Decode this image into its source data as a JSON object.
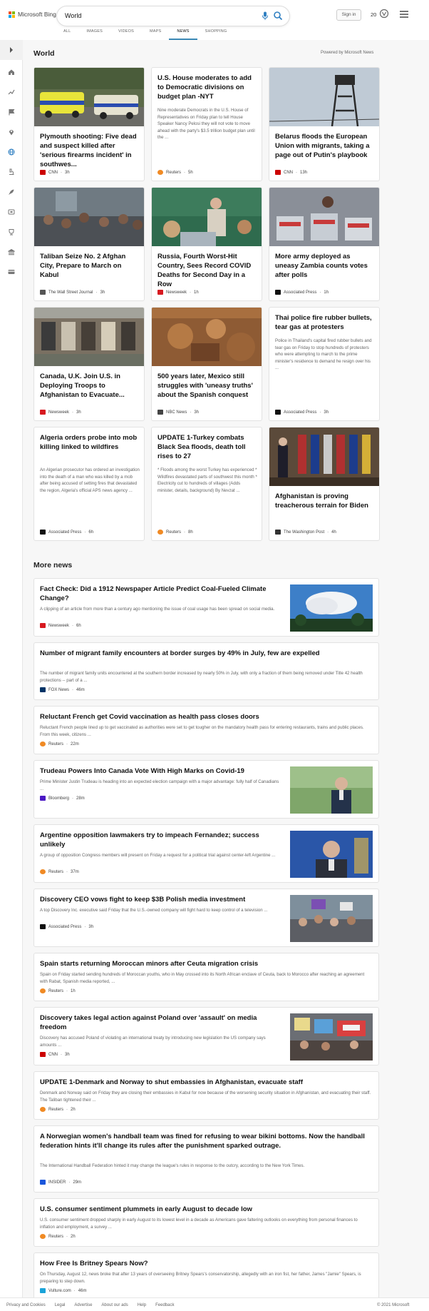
{
  "brand": {
    "name": "Microsoft Bing",
    "colors": [
      "#f25022",
      "#7fba00",
      "#00a4ef",
      "#ffb900"
    ]
  },
  "search": {
    "query": "World"
  },
  "header": {
    "signin_label": "Sign in",
    "rewards_count": "20"
  },
  "tabs": [
    {
      "label": "ALL",
      "active": false
    },
    {
      "label": "IMAGES",
      "active": false
    },
    {
      "label": "VIDEOS",
      "active": false
    },
    {
      "label": "MAPS",
      "active": false
    },
    {
      "label": "NEWS",
      "active": true
    },
    {
      "label": "SHOPPING",
      "active": false
    }
  ],
  "rail": {
    "icons": [
      "chevron-right-icon",
      "home-icon",
      "trending-icon",
      "flag-icon",
      "location-pin-icon",
      "globe-icon",
      "microscope-icon",
      "rocket-icon",
      "entertainment-icon",
      "sports-icon",
      "finance-icon",
      "credit-card-icon"
    ]
  },
  "world": {
    "title": "World",
    "powered_by": "Powered by Microsoft News",
    "cards": [
      {
        "title": "Plymouth shooting: Five dead and suspect killed after 'serious firearms incident' in southwes...",
        "source": "CNN",
        "time": "3h",
        "logo": "#cc0000",
        "image": "police-cars-photo"
      },
      {
        "title": "U.S. House moderates to add to Democratic divisions on budget plan -NYT",
        "snippet": "Nine moderate Democrats in the U.S. House of Representatives on Friday plan to tell House Speaker Nancy Pelosi they will not vote to move ahead with the party's $3.5 trillion budget plan until the ...",
        "source": "Reuters",
        "time": "5h",
        "logo": "#f08a24"
      },
      {
        "title": "Belarus floods the European Union with migrants, taking a page out of Putin's playbook",
        "source": "CNN",
        "time": "13h",
        "logo": "#cc0000",
        "image": "watchtower-photo"
      },
      {
        "title": "Taliban Seize No. 2 Afghan City, Prepare to March on Kabul",
        "source": "The Wall Street Journal",
        "time": "3h",
        "logo": "#555555",
        "image": "crowd-photo"
      },
      {
        "title": "Russia, Fourth Worst-Hit Country, Sees Record COVID Deaths for Second Day in a Row",
        "source": "Newsweek",
        "time": "1h",
        "logo": "#d71920",
        "image": "classroom-photo"
      },
      {
        "title": "More army deployed as uneasy Zambia counts votes after polls",
        "source": "Associated Press",
        "time": "1h",
        "logo": "#111111",
        "image": "ballot-boxes-photo"
      },
      {
        "title": "Canada, U.K. Join U.S. in Deploying Troops to Afghanistan to Evacuate...",
        "source": "Newsweek",
        "time": "3h",
        "logo": "#d71920",
        "image": "mural-wall-photo"
      },
      {
        "title": "500 years later, Mexico still struggles with 'uneasy truths' about the Spanish conquest",
        "source": "NBC News",
        "time": "3h",
        "logo": "#444444",
        "image": "painting-photo"
      },
      {
        "title": "Thai police fire rubber bullets, tear gas at protesters",
        "snippet": "Police in Thailand's capital fired rubber bullets and tear gas on Friday to stop hundreds of protesters who were attempting to march to the prime minister's residence to demand he resign over his ...",
        "source": "Associated Press",
        "time": "3h",
        "logo": "#111111"
      },
      {
        "title": "Algeria orders probe into mob killing linked to wildfires",
        "snippet": "An Algerian prosecutor has ordered an investigation into the death of a man who was killed by a mob after being accused of setting fires that devastated the region, Algeria's official APS news agency ...",
        "source": "Associated Press",
        "time": "6h",
        "logo": "#111111"
      },
      {
        "title": "UPDATE 1-Turkey combats Black Sea floods, death toll rises to 27",
        "snippet": "* Floods among the worst Turkey has experienced * Wildfires devastated parts of southwest this month * Electricity cut to hundreds of villages (Adds minister, details, background) By Nevzat ...",
        "source": "Reuters",
        "time": "8h",
        "logo": "#f08a24"
      },
      {
        "title": "Afghanistan is proving treacherous terrain for Biden",
        "source": "The Washington Post",
        "time": "4h",
        "logo": "#333333",
        "image": "flags-photo"
      }
    ]
  },
  "more_news": {
    "title": "More news",
    "items": [
      {
        "title": "Fact Check: Did a 1912 Newspaper Article Predict Coal-Fueled Climate Change?",
        "snippet": "A clipping of an article from more than a century ago mentioning the issue of coal usage has been spread on social media.",
        "source": "Newsweek",
        "time": "6h",
        "logo": "#d71920",
        "image": "smokestack-cloud-photo"
      },
      {
        "title": "Number of migrant family encounters at border surges by 49% in July, few are expelled",
        "snippet": "The number of migrant family units encountered at the southern border increased by nearly 50% in July, with only a fraction of them being removed under Title 42 health protections -- part of a ...",
        "source": "FOX News",
        "time": "46m",
        "logo": "#003366"
      },
      {
        "title": "Reluctant French get Covid vaccination as health pass closes doors",
        "snippet": "Reluctant French people lined up to get vaccinated as authorities were set to get tougher on the mandatory health pass for entering restaurants, trains and public places. From this week, citizens ...",
        "source": "Reuters",
        "time": "22m",
        "logo": "#f08a24"
      },
      {
        "title": "Trudeau Powers Into Canada Vote With High Marks on Covid-19",
        "snippet": "Prime Minister Justin Trudeau is heading into an expected election campaign with a major advantage: fully half of Canadians ...",
        "source": "Bloomberg",
        "time": "28m",
        "logo": "#4b19c4",
        "image": "trudeau-photo"
      },
      {
        "title": "Argentine opposition lawmakers try to impeach Fernandez; success unlikely",
        "snippet": "A group of opposition Congress members will present on Friday a request for a political trial against center-left Argentine ...",
        "source": "Reuters",
        "time": "37m",
        "logo": "#f08a24",
        "image": "fernandez-photo"
      },
      {
        "title": "Discovery CEO vows fight to keep $3B Polish media investment",
        "snippet": "A top Discovery Inc. executive said Friday that the U.S.-owned company will fight hard to keep control of a television ...",
        "source": "Associated Press",
        "time": "3h",
        "logo": "#111111",
        "image": "protest-photo"
      },
      {
        "title": "Spain starts returning Moroccan minors after Ceuta migration crisis",
        "snippet": "Spain on Friday started sending hundreds of Moroccan youths, who in May crossed into its North African enclave of Ceuta, back to Morocco after reaching an agreement with Rabat, Spanish media reported, ...",
        "source": "Reuters",
        "time": "1h",
        "logo": "#f08a24"
      },
      {
        "title": "Discovery takes legal action against Poland over 'assault' on media freedom",
        "snippet": "Discovery has accused Poland of violating an international treaty by introducing new legislation the US company says amounts ...",
        "source": "CNN",
        "time": "3h",
        "logo": "#cc0000",
        "image": "stop-signs-photo"
      },
      {
        "title": "UPDATE 1-Denmark and Norway to shut embassies in Afghanistan, evacuate staff",
        "snippet": "Denmark and Norway said on Friday they are closing their embassies in Kabul for now because of the worsening security situation in Afghanistan, and evacuating their staff. The Taliban tightened their ...",
        "source": "Reuters",
        "time": "2h",
        "logo": "#f08a24"
      },
      {
        "title": "A Norwegian women's handball team was fined for refusing to wear bikini bottoms. Now the handball federation hints it'll change its rules after the punishment sparked outrage.",
        "snippet": "The International Handball Federation hinted it may change the league's rules in response to the outcry, according to the New York Times.",
        "source": "INSIDER",
        "time": "29m",
        "logo": "#1a56db"
      },
      {
        "title": "U.S. consumer sentiment plummets in early August to decade low",
        "snippet": "U.S. consumer sentiment dropped sharply in early August to its lowest level in a decade as Americans gave faltering outlooks on everything from personal finances to inflation and employment, a survey ...",
        "source": "Reuters",
        "time": "2h",
        "logo": "#f08a24"
      },
      {
        "title": "How Free Is Britney Spears Now?",
        "snippet": "On Thursday, August 12, news broke that after 13 years of overseeing Britney Spears's conservatorship, allegedly with an iron fist, her father, James \"Jamie\" Spears, is preparing to step down.",
        "source": "Vulture.com",
        "time": "46m",
        "logo": "#1aa3d9"
      }
    ]
  },
  "footer": {
    "links": [
      "Privacy and Cookies",
      "Legal",
      "Advertise",
      "About our ads",
      "Help",
      "Feedback"
    ],
    "copyright": "© 2021 Microsoft"
  }
}
